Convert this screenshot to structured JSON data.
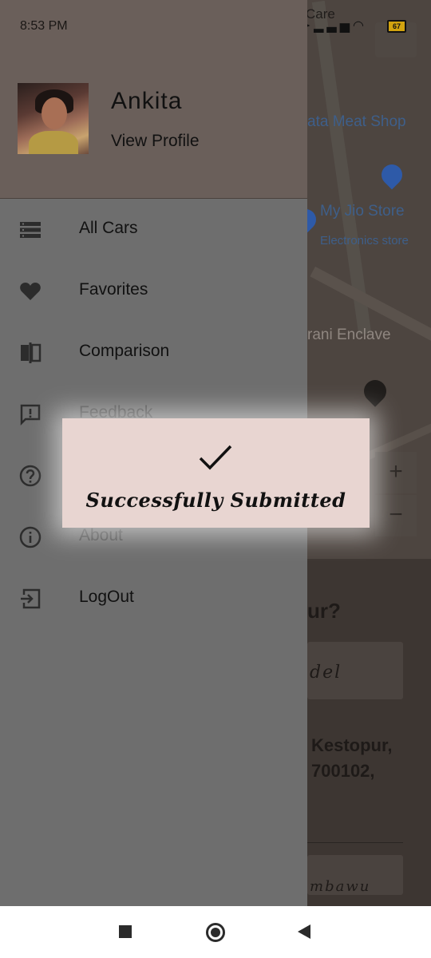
{
  "status_bar": {
    "time": "8:53 PM",
    "carrier_partial": "Care",
    "battery_level": "67",
    "icons": [
      "location-icon",
      "signal-icon",
      "wifi-icon",
      "battery-icon"
    ]
  },
  "background": {
    "map_labels": {
      "meat_shop": "ata Meat Shop",
      "jio_store": "My Jio Store",
      "jio_category": "Electronics store",
      "enclave": "rani Enclave"
    },
    "zoom_in": "+",
    "zoom_out": "−",
    "heading_partial": "ur?",
    "field1_partial": "del",
    "address_line1": "Kestopur,",
    "address_line2": "700102,",
    "field2_partial": "mbawu"
  },
  "drawer": {
    "user": {
      "name": "Ankita",
      "view_profile": "View Profile"
    },
    "items": [
      {
        "label": "All Cars",
        "icon": "list-icon"
      },
      {
        "label": "Favorites",
        "icon": "heart-icon"
      },
      {
        "label": "Comparison",
        "icon": "compare-icon"
      },
      {
        "label": "Feedback",
        "icon": "feedback-icon"
      },
      {
        "label": "",
        "icon": "help-icon"
      },
      {
        "label": "About",
        "icon": "info-icon"
      },
      {
        "label": "LogOut",
        "icon": "logout-icon"
      }
    ]
  },
  "toast": {
    "message": "Successfully Submitted",
    "icon": "checkmark-icon"
  },
  "nav_bar": {
    "buttons": [
      "recent-apps-button",
      "home-button",
      "back-button"
    ]
  },
  "colors": {
    "drawer_bg": "#6e6e6e",
    "header_bg": "#6a5f5a",
    "toast_bg": "#e8d5d1"
  }
}
